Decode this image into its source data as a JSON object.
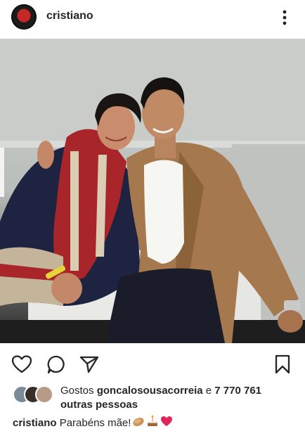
{
  "post": {
    "username": "cristiano",
    "header_icon": "more-vertical-icon"
  },
  "actions": {
    "like_icon": "heart-icon",
    "comment_icon": "comment-icon",
    "share_icon": "send-icon",
    "save_icon": "bookmark-icon"
  },
  "likes": {
    "prefix": "Gostos",
    "liker": "goncalosousacorreia",
    "connector": "e",
    "count": "7 770 761",
    "suffix": "outras pessoas"
  },
  "caption": {
    "username": "cristiano",
    "text": "Parabéns mãe!",
    "emojis": [
      "clapping-hands-emoji",
      "birthday-cake-emoji",
      "red-heart-emoji"
    ]
  },
  "colors": {
    "text": "#262626",
    "heart": "#e0245e",
    "background": "#ffffff"
  }
}
